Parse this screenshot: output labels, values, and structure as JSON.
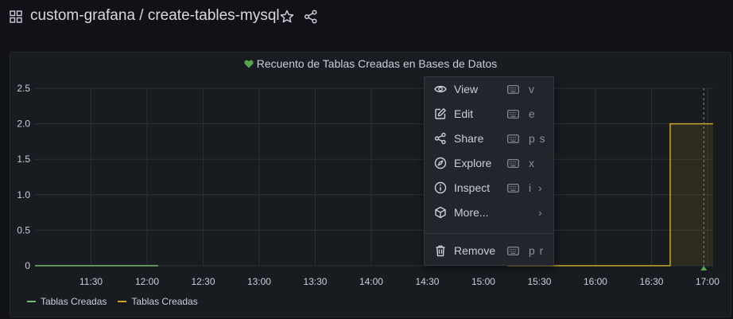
{
  "header": {
    "breadcrumb": "custom-grafana / create-tables-mysql",
    "icons": [
      "dashboard-grid-icon",
      "star-icon",
      "share-icon"
    ]
  },
  "panel": {
    "title": "Recuento de Tablas Creadas en Bases de Datos",
    "status_icon": "heart-icon",
    "status_color": "#56a64b"
  },
  "chart_data": {
    "type": "line",
    "title": "Recuento de Tablas Creadas en Bases de Datos",
    "xlabel": "",
    "ylabel": "",
    "ylim": [
      0,
      2.5
    ],
    "y_ticks": [
      "0",
      "0.5",
      "1.0",
      "1.5",
      "2.0",
      "2.5"
    ],
    "x_ticks": [
      "11:30",
      "12:00",
      "12:30",
      "13:00",
      "13:30",
      "14:00",
      "14:30",
      "15:00",
      "15:30",
      "16:00",
      "16:30",
      "17:00"
    ],
    "xlim": [
      "11:00",
      "17:03"
    ],
    "grid": true,
    "legend_position": "bottom-left",
    "series": [
      {
        "name": "Tablas Creadas",
        "color": "#73bf69",
        "points": [
          [
            "11:00",
            0
          ],
          [
            "12:06",
            0
          ]
        ]
      },
      {
        "name": "Tablas Creadas",
        "color": "#c8a72c",
        "fill": true,
        "points": [
          [
            "15:13",
            0
          ],
          [
            "16:40",
            0
          ],
          [
            "16:40",
            2
          ],
          [
            "17:03",
            2
          ]
        ]
      }
    ],
    "annotation": {
      "x": "16:58",
      "color": "#56a64b",
      "style": "dashed"
    }
  },
  "context_menu": {
    "items": [
      {
        "label": "View",
        "icon": "eye-icon",
        "shortcut": "v",
        "has_submenu": false
      },
      {
        "label": "Edit",
        "icon": "edit-icon",
        "shortcut": "e",
        "has_submenu": false
      },
      {
        "label": "Share",
        "icon": "share-icon",
        "shortcut": "p s",
        "has_submenu": false
      },
      {
        "label": "Explore",
        "icon": "compass-icon",
        "shortcut": "x",
        "has_submenu": false
      },
      {
        "label": "Inspect",
        "icon": "info-icon",
        "shortcut": "i",
        "has_submenu": true
      },
      {
        "label": "More...",
        "icon": "cube-icon",
        "shortcut": "",
        "has_submenu": true
      },
      {
        "label": "Remove",
        "icon": "trash-icon",
        "shortcut": "p r",
        "has_submenu": false
      }
    ]
  }
}
